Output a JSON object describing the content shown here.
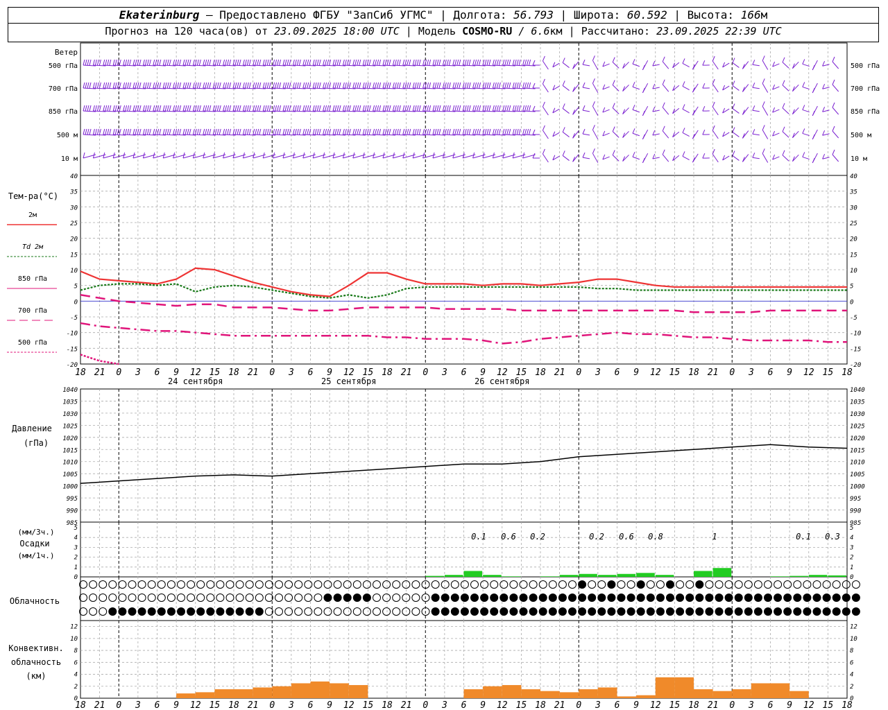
{
  "header": {
    "city": "Ekaterinburg",
    "provider": "– Предоставлено ФГБУ \"ЗапСиб УГМС\"",
    "lon_label": "Долгота:",
    "lon": "56.793",
    "lat_label": "Широта:",
    "lat": "60.592",
    "alt_label": "Высота:",
    "alt": "166",
    "alt_unit": "м",
    "forecast_prefix": "Прогноз на 120 часа(ов) от",
    "forecast_start": "23.09.2025 18:00 UTC",
    "model_label": "Модель",
    "model": "COSMO-RU",
    "model_res": "/ 6.6",
    "model_res_unit": "км",
    "calc_label": "Рассчитано:",
    "calc_time": "23.09.2025 22:39 UTC"
  },
  "wind_panel": {
    "title": "Ветер",
    "levels": [
      "500 гПа",
      "700 гПа",
      "850 гПа",
      "500 м",
      "10  м"
    ]
  },
  "temp_panel": {
    "title": "Тем-ра(°C)",
    "legend": [
      {
        "label": "2м",
        "color": "#ee3333",
        "dash": ""
      },
      {
        "label": "Td  2м",
        "color": "#1a7a1a",
        "dash": "3,2"
      },
      {
        "label": "850 гПа",
        "color": "#e0147a",
        "dash": ""
      },
      {
        "label": "700 гПа",
        "color": "#e0147a",
        "dash": "12,6"
      },
      {
        "label": "500 гПа",
        "color": "#e0147a",
        "dash": "3,2"
      }
    ],
    "dates": [
      "24 сентября",
      "25 сентября",
      "26 сентября"
    ]
  },
  "pressure_panel": {
    "label1": "Давление",
    "label2": "(гПа)"
  },
  "precip_panel": {
    "label1": "(мм/3ч.)",
    "label2": "Осадки",
    "label3": "(мм/1ч.)",
    "annotations": [
      "0.1",
      "0.6",
      "0.2",
      "0.2",
      "0.6",
      "0.8",
      "1",
      "0.1",
      "0.3"
    ]
  },
  "cloud_panel": {
    "label": "Облачность"
  },
  "conv_panel": {
    "label1": "Конвективн.",
    "label2": "облачность",
    "label3": "(км)"
  },
  "hour_ticks": [
    "18",
    "21",
    "0",
    "3",
    "6",
    "9",
    "12",
    "15",
    "18",
    "21",
    "0",
    "3",
    "6",
    "9",
    "12",
    "15",
    "18",
    "21",
    "0",
    "3",
    "6",
    "9",
    "12",
    "15",
    "18",
    "21",
    "0",
    "3",
    "6",
    "9",
    "12",
    "15",
    "18",
    "21",
    "0",
    "3",
    "6",
    "9",
    "12",
    "15",
    "18",
    "21",
    "0"
  ],
  "colors": {
    "wind": "#7a1fd0",
    "t2m": "#ee3333",
    "td": "#1a7a1a",
    "upper": "#e0147a",
    "pressure": "#000000",
    "precip": "#22cc22",
    "conv": "#f08a2a"
  },
  "chart_data": [
    {
      "type": "line",
      "title": "Тем-ра(°C)",
      "x_hours_from_start": [
        0,
        3,
        6,
        9,
        12,
        15,
        18,
        21,
        24,
        27,
        30,
        33,
        36,
        39,
        42,
        45,
        48,
        51,
        54,
        57,
        60,
        63,
        66,
        69,
        72,
        75,
        78,
        81,
        84,
        87,
        90,
        93,
        96,
        99,
        102,
        105,
        108,
        111,
        114,
        117,
        120
      ],
      "ylim": [
        -20,
        40
      ],
      "series": [
        {
          "name": "2м",
          "values": [
            9.5,
            7,
            6.5,
            6,
            5.5,
            7,
            10.5,
            10,
            8,
            6,
            4.5,
            3,
            2,
            1.5,
            5,
            9,
            9,
            7,
            5.5,
            5.5,
            5.5,
            5,
            5.5,
            5.5,
            5,
            5.5,
            6,
            7,
            7,
            6,
            5,
            4.5,
            4.5,
            4.5,
            4.5,
            4.5,
            4.5,
            4.5,
            4.5,
            4.5,
            4.5
          ]
        },
        {
          "name": "Td  2м",
          "values": [
            3.5,
            5,
            5.5,
            5.5,
            5,
            5.5,
            3,
            4.5,
            5,
            4.5,
            3.5,
            2.5,
            1.5,
            1,
            2,
            1,
            2,
            4,
            4.5,
            4.5,
            4.5,
            4.5,
            4.5,
            4.5,
            4.5,
            4.5,
            4.5,
            4,
            4,
            3.5,
            3.5,
            3.5,
            3.5,
            3.5,
            3.5,
            3.5,
            3.5,
            3.5,
            3.5,
            3.5,
            3.5
          ]
        },
        {
          "name": "850 гПа",
          "values": [
            2,
            1,
            0,
            -0.5,
            -1,
            -1.5,
            -1,
            -1,
            -2,
            -2,
            -2,
            -2.5,
            -3,
            -3,
            -2.5,
            -2,
            -2,
            -2,
            -2,
            -2.5,
            -2.5,
            -2.5,
            -2.5,
            -3,
            -3,
            -3,
            -3,
            -3,
            -3,
            -3,
            -3,
            -3,
            -3.5,
            -3.5,
            -3.5,
            -3.5,
            -3,
            -3,
            -3,
            -3,
            -3
          ]
        },
        {
          "name": "700 гПа",
          "values": [
            -7,
            -8,
            -8.5,
            -9,
            -9.5,
            -9.5,
            -10,
            -10.5,
            -11,
            -11,
            -11,
            -11,
            -11,
            -11,
            -11,
            -11,
            -11.5,
            -11.5,
            -12,
            -12,
            -12,
            -12.5,
            -13.5,
            -13,
            -12,
            -11.5,
            -11,
            -10.5,
            -10,
            -10.5,
            -10.5,
            -11,
            -11.5,
            -11.5,
            -12,
            -12.5,
            -12.5,
            -12.5,
            -12.5,
            -13,
            -13
          ]
        },
        {
          "name": "500 гПа",
          "values": [
            -17,
            -19,
            -20
          ]
        }
      ]
    },
    {
      "type": "line",
      "title": "Давление",
      "ylabel": "(гПа)",
      "x_hours_from_start": [
        0,
        6,
        12,
        18,
        24,
        30,
        36,
        42,
        48,
        54,
        60,
        66,
        72,
        78,
        84,
        90,
        96,
        102,
        108,
        114,
        120
      ],
      "ylim": [
        985,
        1040
      ],
      "values": [
        1001,
        1002,
        1003,
        1004,
        1004.5,
        1004,
        1005,
        1006,
        1007,
        1008,
        1009,
        1009,
        1010,
        1012,
        1013,
        1014,
        1015,
        1016,
        1017,
        1016,
        1015.5
      ]
    },
    {
      "type": "bar",
      "title": "Осадки",
      "bar_hours_from_start": [
        54,
        57,
        60,
        63,
        66,
        69,
        72,
        75,
        78,
        81,
        84,
        87,
        90,
        93,
        96,
        99,
        102,
        105,
        108,
        111,
        114,
        117
      ],
      "values": [
        0.1,
        0.2,
        0.6,
        0.2,
        0.05,
        0,
        0.05,
        0.2,
        0.3,
        0.2,
        0.3,
        0.4,
        0.2,
        0,
        0.6,
        0.9,
        0,
        0,
        0.05,
        0.1,
        0.2,
        0.15
      ],
      "ylim": [
        0,
        5
      ]
    },
    {
      "type": "bar",
      "title": "Конвективн. облачность",
      "ylabel": "(км)",
      "bar_hours_from_start": [
        15,
        18,
        21,
        24,
        27,
        30,
        33,
        36,
        39,
        42,
        45,
        48,
        51,
        54,
        57,
        60,
        63,
        66,
        69,
        72,
        75,
        78,
        81,
        84,
        87,
        90,
        93,
        96,
        99,
        102,
        105,
        108,
        111
      ],
      "values": [
        0.8,
        1,
        1.5,
        1.5,
        1.8,
        2,
        2.5,
        2.8,
        2.5,
        2.2,
        0,
        0,
        0,
        0,
        0,
        1.5,
        2,
        2.2,
        1.5,
        1.2,
        1,
        1.5,
        1.8,
        0.3,
        0.5,
        3.5,
        3.5,
        1.5,
        1.2,
        1.5,
        2.5,
        2.5,
        1.2
      ]
    }
  ]
}
